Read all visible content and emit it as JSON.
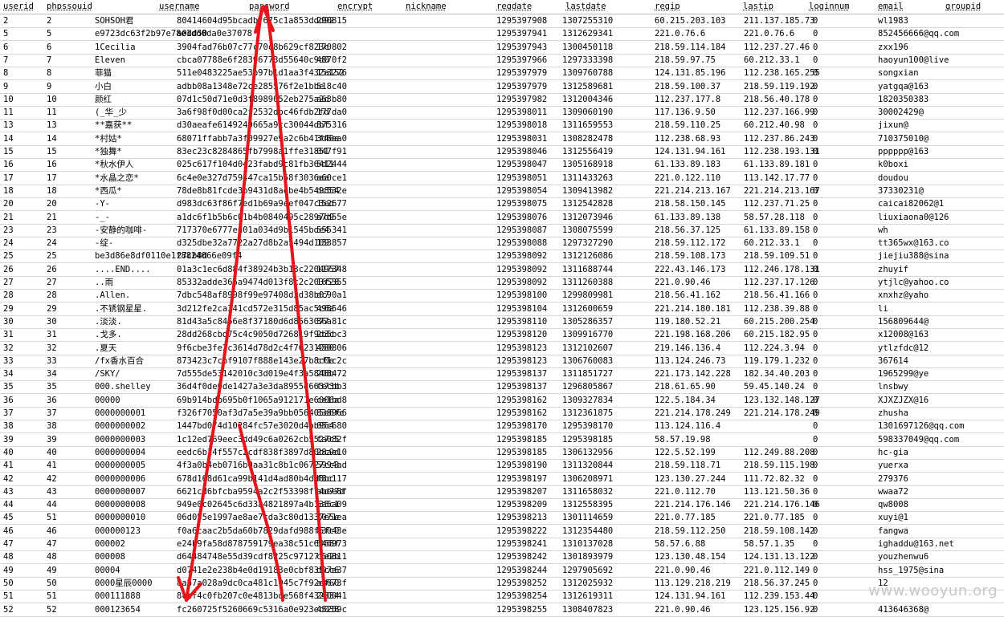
{
  "table": {
    "columns": [
      "userid",
      "phpssouid",
      "username",
      "password",
      "encrypt",
      "nickname",
      "regdate",
      "lastdate",
      "regip",
      "lastip",
      "loginnum",
      "email",
      "groupid"
    ],
    "rows": [
      [
        "2",
        "2",
        "SOHSOH君",
        "80414604d95bcadbf675c1a853ddd92",
        "290815",
        "",
        "1295397908",
        "1307255310",
        "60.215.203.103",
        "211.137.185.73",
        "0",
        "wl1983",
        ""
      ],
      [
        "5",
        "5",
        "e9723dc63f2b97e78e1dd0da0e37078",
        "a0dd50",
        "",
        "",
        "1295397941",
        "1312629341",
        "221.0.76.6",
        "221.0.76.6",
        "0",
        "852456666@qq.com",
        ""
      ],
      [
        "6",
        "6",
        "1Cecilia",
        "3904fad76b07c77c70c8b629cf823c",
        "170802",
        "",
        "1295397943",
        "1300450118",
        "218.59.114.184",
        "112.237.27.46",
        "0",
        "zxx196",
        ""
      ],
      [
        "7",
        "7",
        "Eleven",
        "cbca07788e6f28396773d55640c9d0",
        "4870f2",
        "",
        "1295397966",
        "1297333398",
        "218.59.97.75",
        "60.212.33.1",
        "0",
        "haoyun100@live",
        ""
      ],
      [
        "8",
        "8",
        "菲猫",
        "511e0483225ae53b97b1d1aa3f432a152",
        "153276",
        "",
        "1295397979",
        "1309760788",
        "124.131.85.196",
        "112.238.165.255",
        "0",
        "songxian",
        ""
      ],
      [
        "9",
        "9",
        "小白",
        "adbb08a1348e72ce285576f2e1bbe",
        "518c40",
        "",
        "1295397979",
        "1312589681",
        "218.59.100.37",
        "218.59.119.192",
        "0",
        "yatgqa@163",
        ""
      ],
      [
        "10",
        "10",
        "颜红",
        "07d1c50d71e0d3f8989052eb275a2d",
        "a63b80",
        "",
        "1295397982",
        "1312004346",
        "112.237.177.8",
        "218.56.40.178",
        "0",
        "1820350383",
        ""
      ],
      [
        "11",
        "11",
        "(_华_少",
        "3a6f98f0d00ca2f2532dbc46fdb2fd",
        "177da0",
        "",
        "1295398011",
        "1309060190",
        "117.136.9.50",
        "112.237.166.99",
        "0",
        "30002429@",
        ""
      ],
      [
        "13",
        "13",
        "**嘉获**",
        "d30aeafe6149249665a9cc30044dbf",
        "875316",
        "",
        "1295398018",
        "1311659553",
        "218.59.110.25",
        "60.212.40.98",
        "0",
        "jixun@",
        ""
      ],
      [
        "14",
        "14",
        "*村姑*",
        "68071ffabb7a3f09927e9a2c6b41f40e",
        "3d6ea0",
        "",
        "1295398031",
        "1308282478",
        "112.238.68.93",
        "112.237.86.243",
        "0",
        "710375010@",
        ""
      ],
      [
        "15",
        "15",
        "*独舞*",
        "83ec23c8284865fb7998a1ffe31851",
        "047f91",
        "",
        "1295398046",
        "1312556419",
        "124.131.94.161",
        "112.238.193.131",
        "0",
        "pppppp@163",
        ""
      ],
      [
        "16",
        "16",
        "*秋水伊人",
        "025c617f104d0423fabd9c81fb36411",
        "5d2444",
        "",
        "1295398047",
        "1305168918",
        "61.133.89.183",
        "61.133.89.181",
        "0",
        "k0boxi",
        ""
      ],
      [
        "17",
        "17",
        "*水晶之恋*",
        "6c4e0e327d759447ca15b68f3036aa",
        "a60ce1",
        "",
        "1295398051",
        "1311433263",
        "221.0.122.110",
        "113.142.17.77",
        "0",
        "doudou",
        ""
      ],
      [
        "18",
        "18",
        "*西瓜*",
        "78de8b81fcde3b9431d8aebe4b549854",
        "dc532e",
        "",
        "1295398054",
        "1309413982",
        "221.214.213.167",
        "221.214.213.167",
        "0",
        "37330231@",
        ""
      ],
      [
        "20",
        "20",
        "-Y-",
        "d983dc63f86f7ed1b69a9eef047c3ed",
        "152677",
        "",
        "1295398075",
        "1312542828",
        "218.58.150.145",
        "112.237.71.25",
        "0",
        "caicai82062@1",
        ""
      ],
      [
        "21",
        "21",
        "-_-",
        "a1dc6f1b5b6c01b4b0840495c2897d9",
        "a7d55e",
        "",
        "1295398076",
        "1312073946",
        "61.133.89.138",
        "58.57.28.118",
        "0",
        "liuxiaona0@126",
        ""
      ],
      [
        "23",
        "23",
        "-安静的咖啡-",
        "717370e6777ed01a034d9b1545bde4",
        "555341",
        "",
        "1295398087",
        "1308075599",
        "218.56.37.125",
        "61.133.89.158",
        "0",
        "wh",
        ""
      ],
      [
        "24",
        "24",
        "-绽-",
        "d325dbe32a7722a27d8b2a5494d109",
        "133857",
        "",
        "1295398088",
        "1297327290",
        "218.59.112.172",
        "60.212.33.1",
        "0",
        "tt365wx@163.co",
        ""
      ],
      [
        "25",
        "25",
        "be3d86e8df0110e1f8824066e09f4",
        "27cb8d",
        "",
        "",
        "1295398092",
        "1312126086",
        "218.59.108.173",
        "218.59.109.51",
        "0",
        "jiejiu388@sina",
        ""
      ],
      [
        "26",
        "26",
        "....END....",
        "01a3c1ec6d884f38924b3b13c2204957",
        "117348",
        "",
        "1295398092",
        "1311688744",
        "222.43.146.173",
        "112.246.178.131",
        "0",
        "zhuyif",
        ""
      ],
      [
        "27",
        "27",
        "..雨",
        "85332adde366a9474d013f8c2c203f28",
        "165355",
        "",
        "1295398092",
        "1311260388",
        "221.0.90.46",
        "112.237.17.126",
        "0",
        "ytjlc@yahoo.co",
        ""
      ],
      [
        "28",
        "28",
        ".Allen.",
        "7dbc548af8998f99e97408d3d38b07",
        "dc90a1",
        "",
        "1295398100",
        "1299809981",
        "218.56.41.162",
        "218.56.41.166",
        "0",
        "xnxhz@yaho",
        ""
      ],
      [
        "29",
        "29",
        ".不锈钢星星.",
        "3d212fe2ca341cd572e315d85ac5c6a",
        "498546",
        "",
        "1295398104",
        "1312600659",
        "221.214.180.181",
        "112.238.39.88",
        "0",
        "li",
        ""
      ],
      [
        "30",
        "30",
        ".淡淡.",
        "81d43a5c8456e8f37180d6d8563077",
        "36a81c",
        "",
        "1295398110",
        "1305286357",
        "119.180.52.21",
        "60.215.200.254",
        "0",
        "156809644@",
        ""
      ],
      [
        "31",
        "31",
        ".戈多.",
        "28dd268cbd75c4c9050d726819f9d3c",
        "2b5bc3",
        "",
        "1295398120",
        "1309916770",
        "221.198.168.206",
        "60.215.182.95",
        "0",
        "x12008@163",
        ""
      ],
      [
        "32",
        "32",
        ".夏天",
        "9f6cbe3fe2c3614d78d2c4f76231080",
        "450806",
        "",
        "1295398123",
        "1312102607",
        "219.146.136.4",
        "112.224.3.94",
        "0",
        "ytlzfdc@12",
        ""
      ],
      [
        "33",
        "33",
        "/fx香水百合",
        "873423c7cbf9107f888e143e27b8c0e",
        "cf1c2c",
        "",
        "1295398123",
        "1306760083",
        "113.124.246.73",
        "119.179.1.232",
        "0",
        "367614",
        ""
      ],
      [
        "34",
        "34",
        "/SKY/",
        "7d555de53142010c3d019e4f3a5848b",
        "208472",
        "",
        "1295398137",
        "1311851727",
        "221.173.142.228",
        "182.34.40.203",
        "0",
        "1965299@ye",
        ""
      ],
      [
        "35",
        "35",
        "000.shelley",
        "36d4f0de0de1427a3e3da8955d66373b",
        "fecbb3",
        "",
        "1295398137",
        "1296805867",
        "218.61.65.90",
        "59.45.140.24",
        "0",
        "lnsbwy",
        ""
      ],
      [
        "36",
        "36",
        "00000",
        "69b914bdb695b0f1065a912171e6006a",
        "ce1bd8",
        "",
        "1295398162",
        "1309327834",
        "122.5.184.34",
        "123.132.148.127",
        "0",
        "XJXZJZX@16",
        ""
      ],
      [
        "37",
        "37",
        "0000000001",
        "f326f7050af3d7a5e39a9bb056405e6fc",
        "838966",
        "",
        "1295398162",
        "1312361875",
        "221.214.178.249",
        "221.214.178.249",
        "0",
        "zhusha",
        ""
      ],
      [
        "38",
        "38",
        "0000000002",
        "1447bd074d10284fc57e3020d4bb964",
        "05c680",
        "",
        "1295398170",
        "1295398170",
        "113.124.116.4",
        "",
        "0",
        "1301697126@qq.com",
        ""
      ],
      [
        "39",
        "39",
        "0000000003",
        "1c12ed769eec3dd49c6a0262cb5527c5",
        "fa082f",
        "",
        "1295398185",
        "1295398185",
        "58.57.19.98",
        "",
        "0",
        "598337049@qq.com",
        ""
      ],
      [
        "40",
        "40",
        "0000000004",
        "eedc6b14f557c2cdf838f3897d80bc9d",
        "28ae10",
        "",
        "1295398185",
        "1306132956",
        "122.5.52.199",
        "112.249.88.208",
        "0",
        "hc-gia",
        ""
      ],
      [
        "41",
        "41",
        "0000000005",
        "4f3a0b4eb0716b0aa31c8b1c06727cc3",
        "5994ad",
        "",
        "1295398190",
        "1311320844",
        "218.59.118.71",
        "218.59.115.198",
        "0",
        "yuerxa",
        ""
      ],
      [
        "42",
        "42",
        "0000000006",
        "678d168d61ca99b141d4ad80b4dd8bc",
        "f8c117",
        "",
        "1295398197",
        "1306208971",
        "123.130.27.244",
        "111.72.82.32",
        "0",
        "279376",
        ""
      ],
      [
        "43",
        "43",
        "0000000007",
        "6621cd6bfcba9594a2c2f53398f74d77d",
        "abee8f",
        "",
        "1295398207",
        "1311658032",
        "221.0.112.70",
        "113.121.50.36",
        "0",
        "wwaa72",
        ""
      ],
      [
        "44",
        "44",
        "0000000008",
        "949e0c02645c6d33a4821897a4b135c1",
        "5a5a09",
        "",
        "1295398209",
        "1312558395",
        "221.214.176.146",
        "221.214.176.146",
        "0",
        "qw8008",
        ""
      ],
      [
        "45",
        "51",
        "0000000010",
        "06d055e1997ae8ae7cda3c80d1337e5e",
        "7071ea",
        "",
        "1295398213",
        "1301114659",
        "221.0.77.185",
        "221.0.77.185",
        "0",
        "xuyi@1",
        ""
      ],
      [
        "46",
        "46",
        "000000123",
        "f0a6caac2b5da60b7829dafd988f5fc0",
        "83043e",
        "",
        "1295398222",
        "1312354480",
        "218.59.112.250",
        "218.59.108.142",
        "0",
        "fangwa",
        ""
      ],
      [
        "47",
        "47",
        "000002",
        "e24b9fa58d878759179ea38c51c6068f",
        "546973",
        "",
        "1295398241",
        "1310137028",
        "58.57.6.88",
        "58.57.1.35",
        "0",
        "ighaddu@163.net",
        ""
      ],
      [
        "48",
        "48",
        "000008",
        "d64484748e55d39cdf8225c971277e2b",
        "c50811",
        "",
        "1295398242",
        "1301893979",
        "123.130.48.154",
        "124.131.13.122",
        "0",
        "youzhenwu6",
        ""
      ],
      [
        "49",
        "49",
        "00004",
        "d0741e2e238b4e0d19183e0cbf835cc6",
        "d97e37",
        "",
        "1295398244",
        "1297905692",
        "221.0.90.46",
        "221.0.112.149",
        "0",
        "hss_1975@sina",
        ""
      ],
      [
        "50",
        "50",
        "0000星辰0000",
        "8ab7a028a9dc0ca481c1045c7f92ef60",
        "a3673f",
        "",
        "1295398252",
        "1312025932",
        "113.129.218.219",
        "218.56.37.245",
        "0",
        "12",
        ""
      ],
      [
        "51",
        "51",
        "000111888",
        "8cef4c0fb207c0e4813bde568f432834",
        "240041",
        "",
        "1295398254",
        "1312619311",
        "124.131.94.161",
        "112.239.153.44",
        "0",
        "",
        ""
      ],
      [
        "52",
        "52",
        "000123654",
        "fc260725f5260669c5316a0e923eb038",
        "45259c",
        "",
        "1295398255",
        "1308407823",
        "221.0.90.46",
        "123.125.156.92",
        "0",
        "413646368@",
        ""
      ]
    ]
  },
  "watermark": "www.wooyun.org",
  "annotation": {
    "description_color": "#e8141c"
  }
}
